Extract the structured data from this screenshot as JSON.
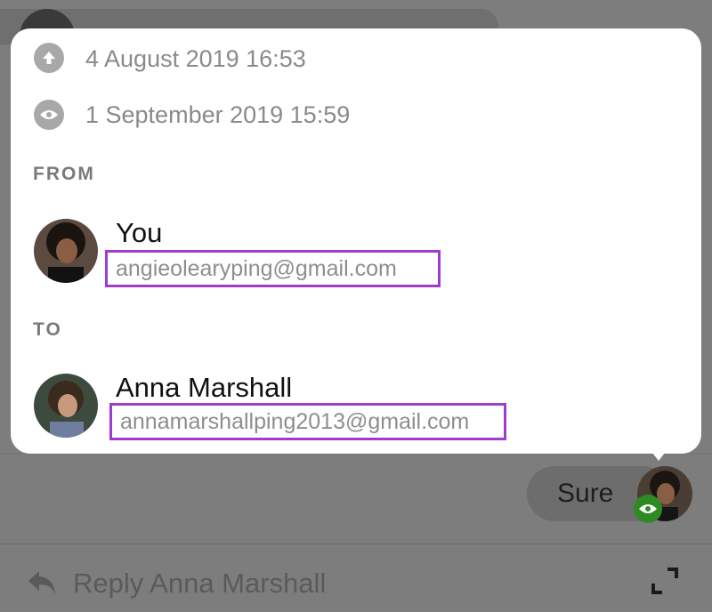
{
  "popover": {
    "sent_time": "4 August 2019 16:53",
    "seen_time": "1 September 2019 15:59",
    "from_label": "FROM",
    "to_label": "TO",
    "from": {
      "name": "You",
      "email": "angieolearyping@gmail.com"
    },
    "to": {
      "name": "Anna Marshall",
      "email": "annamarshallping2013@gmail.com"
    }
  },
  "message": {
    "text": "Sure"
  },
  "reply": {
    "label": "Reply Anna Marshall"
  },
  "icons": {
    "sent": "arrow-up-circle-icon",
    "seen": "eye-icon",
    "reply": "reply-arrow-icon",
    "expand": "expand-icon"
  },
  "colors": {
    "highlight": "#9f3ccf",
    "seen_badge": "#2f8a25"
  }
}
